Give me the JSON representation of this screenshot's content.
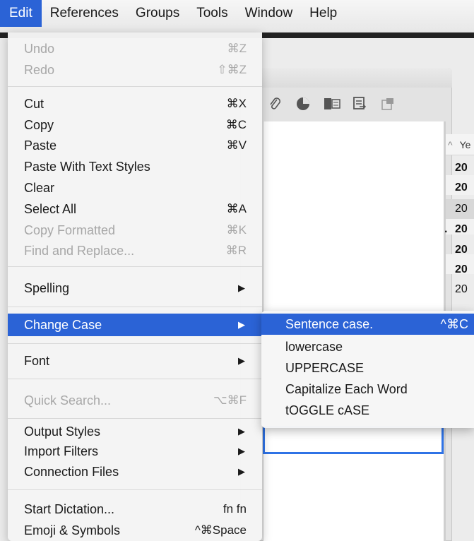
{
  "menubar": {
    "items": [
      "Edit",
      "References",
      "Groups",
      "Tools",
      "Window",
      "Help"
    ]
  },
  "background": {
    "column_header": "Ye",
    "rows": [
      "20",
      "20",
      "20",
      "20",
      "20",
      "20",
      "20"
    ],
    "ellipsis": ".",
    "toolbar_icons": [
      "paperclip-icon",
      "pie-chart-icon",
      "word-doc-icon",
      "export-icon",
      "open-external-icon"
    ]
  },
  "edit_menu": {
    "undo": {
      "label": "Undo",
      "shortcut": "⌘Z"
    },
    "redo": {
      "label": "Redo",
      "shortcut": "⇧⌘Z"
    },
    "cut": {
      "label": "Cut",
      "shortcut": "⌘X"
    },
    "copy": {
      "label": "Copy",
      "shortcut": "⌘C"
    },
    "paste": {
      "label": "Paste",
      "shortcut": "⌘V"
    },
    "paste_styles": {
      "label": "Paste With Text Styles"
    },
    "clear": {
      "label": "Clear"
    },
    "select_all": {
      "label": "Select All",
      "shortcut": "⌘A"
    },
    "copy_formatted": {
      "label": "Copy Formatted",
      "shortcut": "⌘K"
    },
    "find_replace": {
      "label": "Find and Replace...",
      "shortcut": "⌘R"
    },
    "spelling": {
      "label": "Spelling"
    },
    "change_case": {
      "label": "Change Case"
    },
    "font": {
      "label": "Font"
    },
    "quick_search": {
      "label": "Quick Search...",
      "shortcut": "⌥⌘F"
    },
    "output_styles": {
      "label": "Output Styles"
    },
    "import_filters": {
      "label": "Import Filters"
    },
    "connection_files": {
      "label": "Connection Files"
    },
    "start_dictation": {
      "label": "Start Dictation...",
      "shortcut": "fn fn"
    },
    "emoji": {
      "label": "Emoji & Symbols",
      "shortcut": "^⌘Space"
    }
  },
  "submenu": {
    "sentence": {
      "label": "Sentence case.",
      "shortcut": "^⌘C"
    },
    "lower": {
      "label": "lowercase"
    },
    "upper": {
      "label": "UPPERCASE"
    },
    "capitalize": {
      "label": "Capitalize Each Word"
    },
    "toggle": {
      "label": "tOGGLE cASE"
    }
  },
  "colors": {
    "highlight": "#2b63d6",
    "disabled_text": "#a7a7a7",
    "selection_border": "#2f73e6"
  }
}
